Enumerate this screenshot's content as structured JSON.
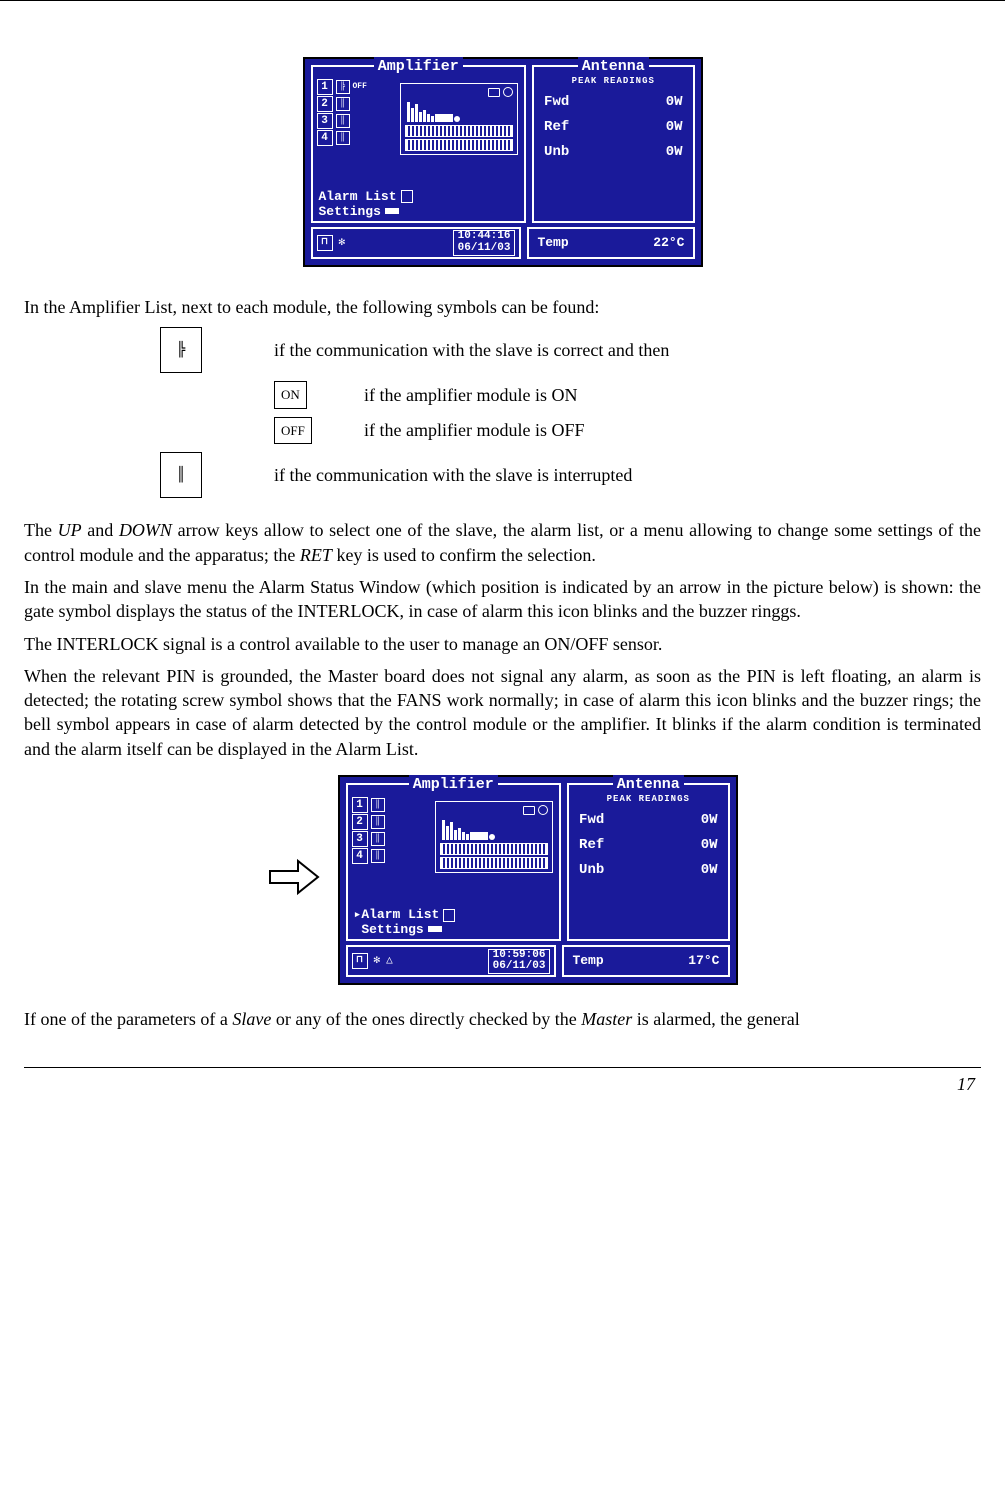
{
  "screen1": {
    "left_title": "Amplifier",
    "right_title": "Antenna",
    "right_sub": "PEAK  READINGS",
    "amp_numbers": [
      "1",
      "2",
      "3",
      "4"
    ],
    "amp_off_label": "OFF",
    "alarm_list": "Alarm List",
    "settings": "Settings",
    "readings": {
      "fwd_label": "Fwd",
      "fwd_val": "0W",
      "ref_label": "Ref",
      "ref_val": "0W",
      "unb_label": "Unb",
      "unb_val": "0W"
    },
    "time": "10:44:16",
    "date": "06/11/03",
    "temp_label": "Temp",
    "temp_val": "22°C",
    "fan_icon": "✻"
  },
  "text": {
    "p1": "In the Amplifier List, next to each module, the following symbols can be found:",
    "sym_ok": "if the communication with the slave is correct and then",
    "on_box": "ON",
    "on_desc": "if the amplifier module is ON",
    "off_box": "OFF",
    "off_desc": "if the amplifier module is OFF",
    "sym_int": "if the communication with the slave is interrupted",
    "p2a": "The ",
    "p2_up": "UP",
    "p2b": " and ",
    "p2_down": "DOWN",
    "p2c": " arrow keys allow to select one of the slave, the alarm list, or a menu allowing to change some settings of the control module and the apparatus; the ",
    "p2_ret": "RET",
    "p2d": " key is used to confirm the selection.",
    "p3": "In the main and slave menu the Alarm Status Window (which position is indicated by an arrow in the picture below) is shown: the gate symbol displays the status of the INTERLOCK, in case of alarm this icon blinks and the buzzer ringgs.",
    "p4": "The INTERLOCK signal is a control available to the user to manage an ON/OFF sensor.",
    "p5": "When the relevant PIN is grounded, the Master board does not signal any alarm, as soon as the PIN is left floating, an alarm is detected; the rotating screw symbol shows that the FANS work normally; in case of alarm this icon blinks and the buzzer rings; the bell symbol appears in case of alarm detected by the control module or the amplifier. It blinks if the alarm condition is terminated and the alarm itself can be displayed in the Alarm List.",
    "p6a": "If one of the parameters of a ",
    "p6_slave": "Slave",
    "p6b": " or any of the ones directly checked by the ",
    "p6_master": "Master",
    "p6c": " is alarmed, the general"
  },
  "screen2": {
    "left_title": "Amplifier",
    "right_title": "Antenna",
    "right_sub": "PEAK  READINGS",
    "amp_numbers": [
      "1",
      "2",
      "3",
      "4"
    ],
    "alarm_list": "Alarm List",
    "settings": "Settings",
    "readings": {
      "fwd_label": "Fwd",
      "fwd_val": "0W",
      "ref_label": "Ref",
      "ref_val": "0W",
      "unb_label": "Unb",
      "unb_val": "0W"
    },
    "time": "10:59:06",
    "date": "06/11/03",
    "temp_label": "Temp",
    "temp_val": "17°C",
    "fan_icon": "✻",
    "bell_icon": "△"
  },
  "page_number": "17"
}
